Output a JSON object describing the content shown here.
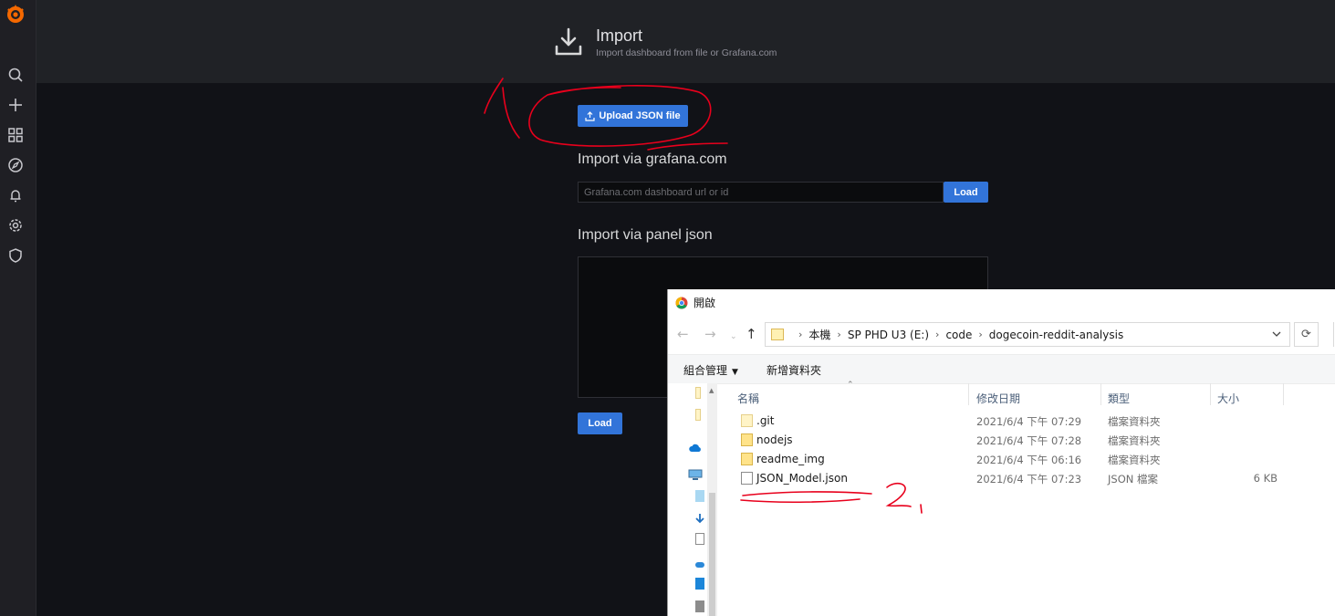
{
  "header": {
    "title": "Import",
    "subtitle": "Import dashboard from file or Grafana.com"
  },
  "main": {
    "upload_label": "Upload JSON file",
    "grafana_com": {
      "title": "Import via grafana.com",
      "placeholder": "Grafana.com dashboard url or id",
      "load_label": "Load"
    },
    "panel_json": {
      "title": "Import via panel json",
      "load_label": "Load"
    }
  },
  "dialog": {
    "title": "開啟",
    "breadcrumbs": [
      "本機",
      "SP PHD U3 (E:)",
      "code",
      "dogecoin-reddit-analysis"
    ],
    "toolbar": {
      "organize_label": "組合管理",
      "new_folder_label": "新增資料夾"
    },
    "columns": {
      "name": "名稱",
      "date": "修改日期",
      "type": "類型",
      "size": "大小"
    },
    "files": [
      {
        "name": ".git",
        "date": "2021/6/4 下午 07:29",
        "type": "檔案資料夾",
        "size": "",
        "icon": "folder-icon"
      },
      {
        "name": "nodejs",
        "date": "2021/6/4 下午 07:28",
        "type": "檔案資料夾",
        "size": "",
        "icon": "folder-icon"
      },
      {
        "name": "readme_img",
        "date": "2021/6/4 下午 06:16",
        "type": "檔案資料夾",
        "size": "",
        "icon": "folder-icon"
      },
      {
        "name": "JSON_Model.json",
        "date": "2021/6/4 下午 07:23",
        "type": "JSON 檔案",
        "size": "6 KB",
        "icon": "file-icon"
      }
    ]
  },
  "annotations": {
    "mark_1": "1",
    "mark_2": "2"
  },
  "colors": {
    "grafana_bg": "#111217",
    "header_bg": "#202226",
    "primary_button": "#3274d9",
    "annotation_red": "#e8001c"
  }
}
